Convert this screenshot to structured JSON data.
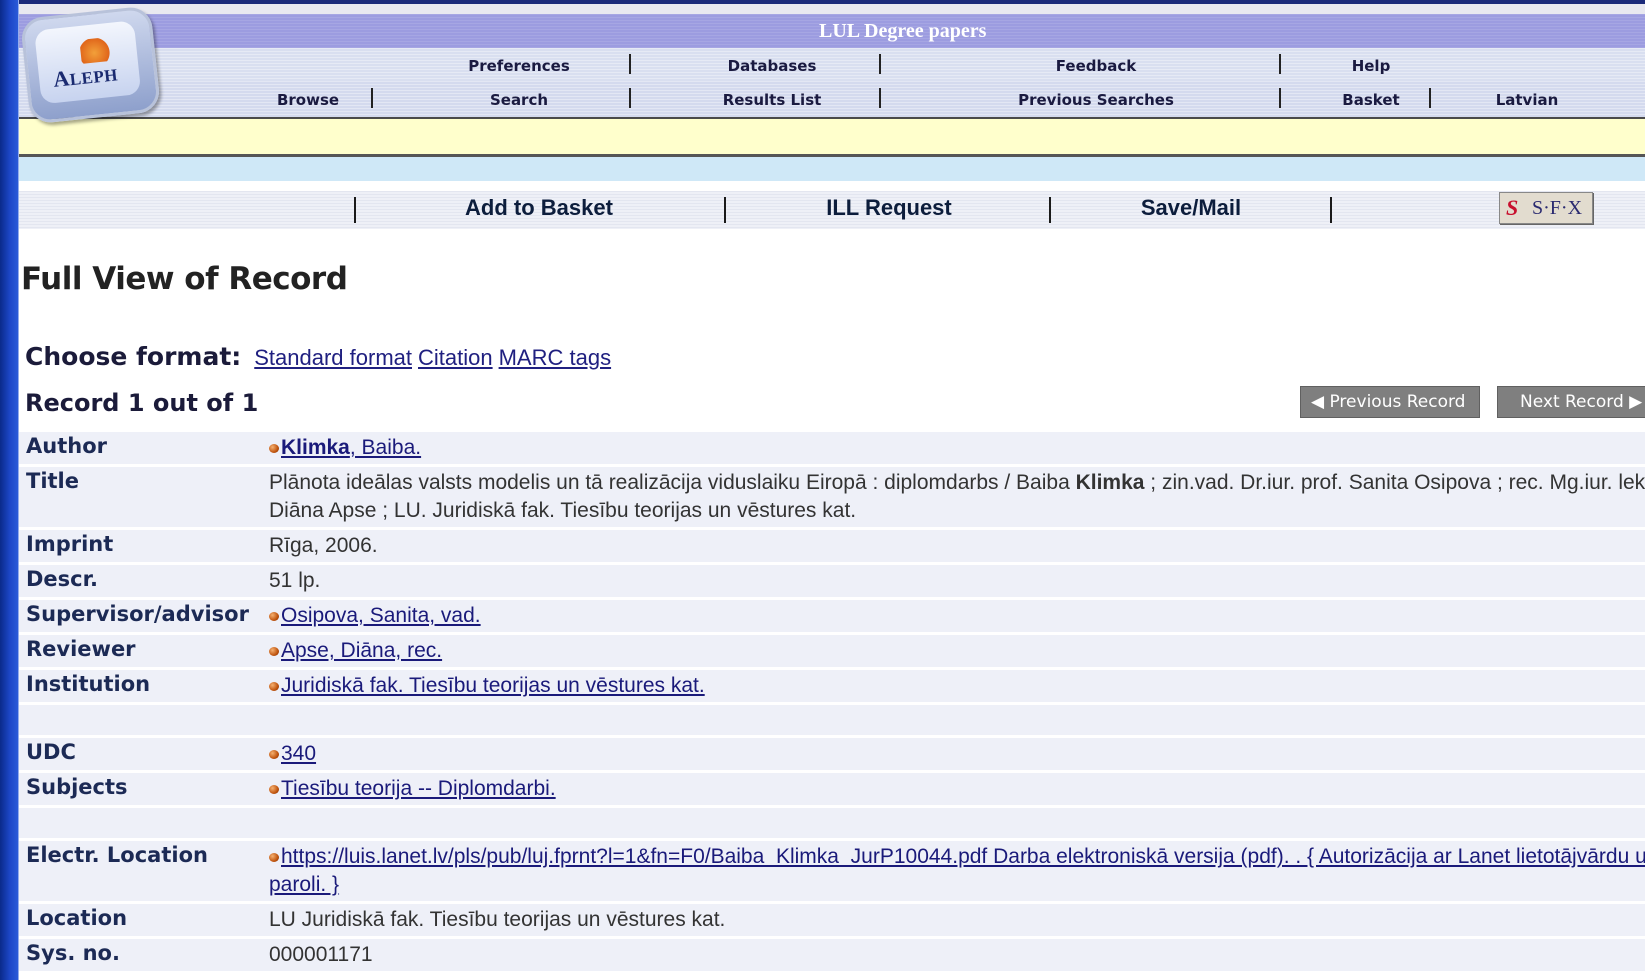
{
  "header": {
    "catalog_title": "LUL Degree papers",
    "logo_text_big": "A",
    "logo_text_small": "LEPH",
    "nav_row1": [
      "Preferences",
      "Databases",
      "Feedback",
      "Help"
    ],
    "nav_row2": [
      "Browse",
      "Search",
      "Results List",
      "Previous Searches",
      "Basket",
      "Latvian"
    ]
  },
  "actions": {
    "add_to_basket": "Add to Basket",
    "ill_request": "ILL Request",
    "save_mail": "Save/Mail",
    "sfx_s": "S",
    "sfx_label": "S·F·X"
  },
  "main": {
    "heading": "Full View of Record",
    "choose_format_label": "Choose format:",
    "formats": [
      "Standard format",
      "Citation",
      "MARC tags"
    ],
    "record_count": "Record 1 out of 1",
    "prev_button": "◀ Previous Record",
    "next_button": "Next Record ▶"
  },
  "record": {
    "author_label": "Author",
    "author_bold": "Klimka",
    "author_rest": ", Baiba.",
    "title_label": "Title",
    "title_part1": "Plānota ideālas valsts modelis un tā realizācija viduslaiku Eiropā : diplomdarbs / Baiba ",
    "title_bold": "Klimka",
    "title_part2": " ; zin.vad. Dr.iur. prof. Sanita Osipova ; rec. Mg.iur. lekt. Diāna Apse ; LU. Juridiskā fak. Tiesību teorijas un vēstures kat.",
    "imprint_label": "Imprint",
    "imprint": "Rīga, 2006.",
    "descr_label": "Descr.",
    "descr": "51 lp.",
    "supervisor_label": "Supervisor/advisor",
    "supervisor": "Osipova, Sanita, vad.",
    "reviewer_label": "Reviewer",
    "reviewer": "Apse, Diāna, rec.",
    "institution_label": "Institution",
    "institution": "Juridiskā fak. Tiesību teorijas un vēstures kat.",
    "udc_label": "UDC",
    "udc": "340",
    "subjects_label": "Subjects",
    "subjects": "Tiesību teorija -- Diplomdarbi.",
    "electr_label": "Electr. Location",
    "electr": "https://luis.lanet.lv/pls/pub/luj.fprnt?l=1&fn=F0/Baiba_Klimka_JurP10044.pdf Darba elektroniskā versija (pdf). .  { Autorizācija ar Lanet lietotājvārdu un paroli. }",
    "location_label": "Location",
    "location": "LU Juridiskā fak. Tiesību teorijas un vēstures kat.",
    "sysno_label": "Sys. no.",
    "sysno": "000001171"
  },
  "colors": {
    "title_band": "#9c9ce0",
    "nav_band": "#d9dff0",
    "yellow_band": "#ffffcc",
    "light_blue_band": "#cfe8f7",
    "row_bg": "#eef0f8",
    "link": "#1a1a7a"
  }
}
